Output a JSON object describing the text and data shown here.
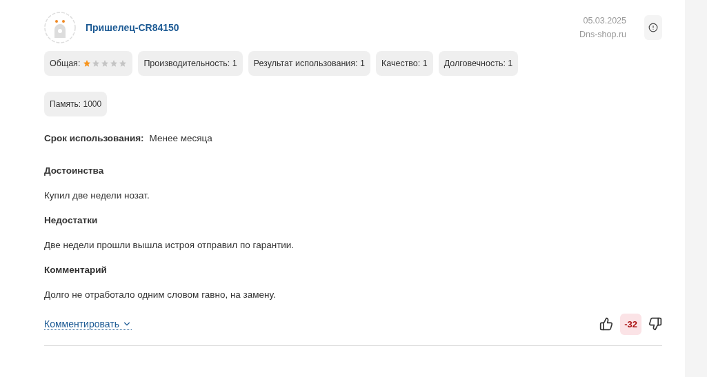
{
  "review": {
    "author": "Пришелец-CR84150",
    "date": "05.03.2025",
    "source": "Dns-shop.ru",
    "ratings": [
      {
        "kind": "stars",
        "label": "Общая:",
        "stars": 1
      },
      {
        "kind": "text",
        "label": "Производительность: 1"
      },
      {
        "kind": "text",
        "label": "Результат использования: 1"
      },
      {
        "kind": "text",
        "label": "Качество: 1"
      },
      {
        "kind": "text",
        "label": "Долговечность: 1"
      },
      {
        "kind": "text",
        "label": "Память: 1000",
        "small": true
      }
    ],
    "usage": {
      "label": "Срок использования:",
      "value": "Менее месяца"
    },
    "sections": [
      {
        "title": "Достоинства",
        "text": "Купил две недели нозат."
      },
      {
        "title": "Недостатки",
        "text": "Две недели прошли вышла истроя отправил по гарантии."
      },
      {
        "title": "Комментарий",
        "text": "Долго не отработало одним словом гавно, на замену."
      }
    ],
    "comment_link": "Комментировать",
    "votes": {
      "score": "-32"
    }
  }
}
